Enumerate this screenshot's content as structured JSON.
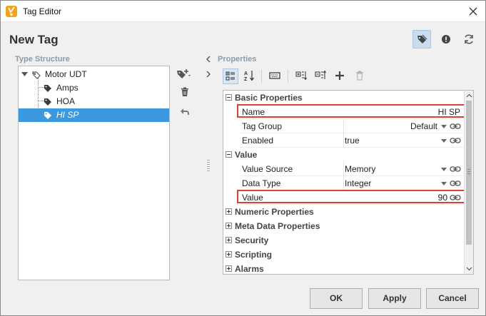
{
  "window": {
    "title": "Tag Editor",
    "accent": "#3c98df",
    "highlight": "#d9403a"
  },
  "header": {
    "title": "New Tag",
    "buttons": [
      "tag-icon",
      "info-icon",
      "refresh-icon"
    ]
  },
  "type_structure": {
    "label": "Type Structure",
    "items": [
      {
        "label": "Motor UDT",
        "icon": "udt-icon",
        "expanded": true
      },
      {
        "label": "Amps",
        "icon": "tag-icon"
      },
      {
        "label": "HOA",
        "icon": "tag-icon"
      },
      {
        "label": "HI SP",
        "icon": "tag-icon",
        "selected": true
      }
    ]
  },
  "side_buttons": [
    "add-tag-icon",
    "delete-icon",
    "undo-icon"
  ],
  "properties": {
    "label": "Properties",
    "toolbar": [
      "categorized-icon",
      "sort-az-icon",
      "keyboard-icon",
      "expand-all-icon",
      "collapse-all-icon",
      "add-icon",
      "delete-icon"
    ],
    "categories": {
      "basic": "Basic Properties",
      "value": "Value",
      "numeric": "Numeric Properties",
      "meta": "Meta Data Properties",
      "security": "Security",
      "scripting": "Scripting",
      "alarms": "Alarms"
    },
    "rows": {
      "name": {
        "label": "Name",
        "value": "HI SP"
      },
      "tag_group": {
        "label": "Tag Group",
        "value": "Default"
      },
      "enabled": {
        "label": "Enabled",
        "value": "true"
      },
      "value_source": {
        "label": "Value Source",
        "value": "Memory"
      },
      "data_type": {
        "label": "Data Type",
        "value": "Integer"
      },
      "value": {
        "label": "Value",
        "value": "90"
      }
    }
  },
  "footer": {
    "ok": "OK",
    "apply": "Apply",
    "cancel": "Cancel"
  }
}
